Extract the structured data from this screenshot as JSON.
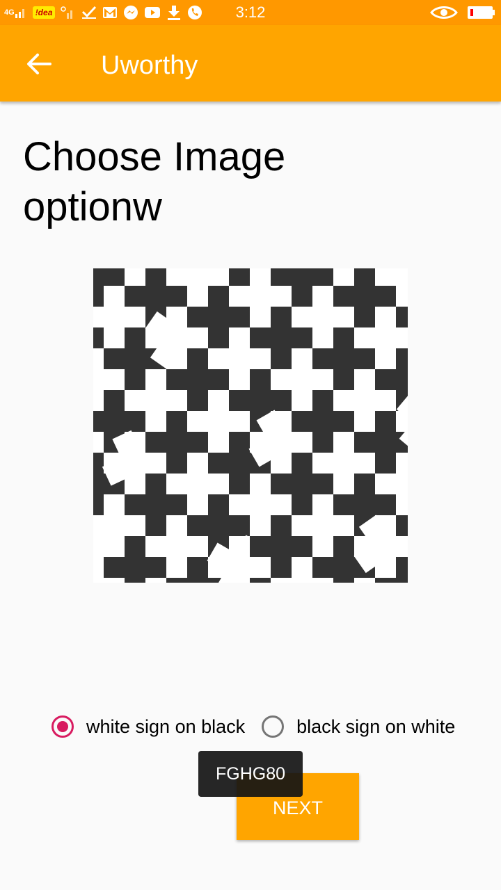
{
  "status_bar": {
    "network": "4G",
    "carrier": "!dea",
    "time": "3:12",
    "icons": [
      "signal-icon",
      "carrier-badge",
      "signal-2-icon",
      "check-icon",
      "gmail-icon",
      "messenger-icon",
      "youtube-icon",
      "download-icon",
      "phone-icon",
      "eye-icon",
      "battery-icon"
    ],
    "battery_level": 0.15
  },
  "app_bar": {
    "title": "Uworthy",
    "back_icon": "arrow-left-icon"
  },
  "main": {
    "heading": "Choose Image optionw",
    "image_semantic": "cross-pattern-image",
    "options": [
      {
        "label": "white sign on black",
        "selected": true
      },
      {
        "label": "black sign on white",
        "selected": false
      }
    ],
    "next_label": "NEXT",
    "toast": "FGHG80"
  },
  "colors": {
    "status_bar": "#ff9800",
    "app_bar": "#ffa500",
    "accent": "#d81b60",
    "pattern_dark": "#333333"
  }
}
